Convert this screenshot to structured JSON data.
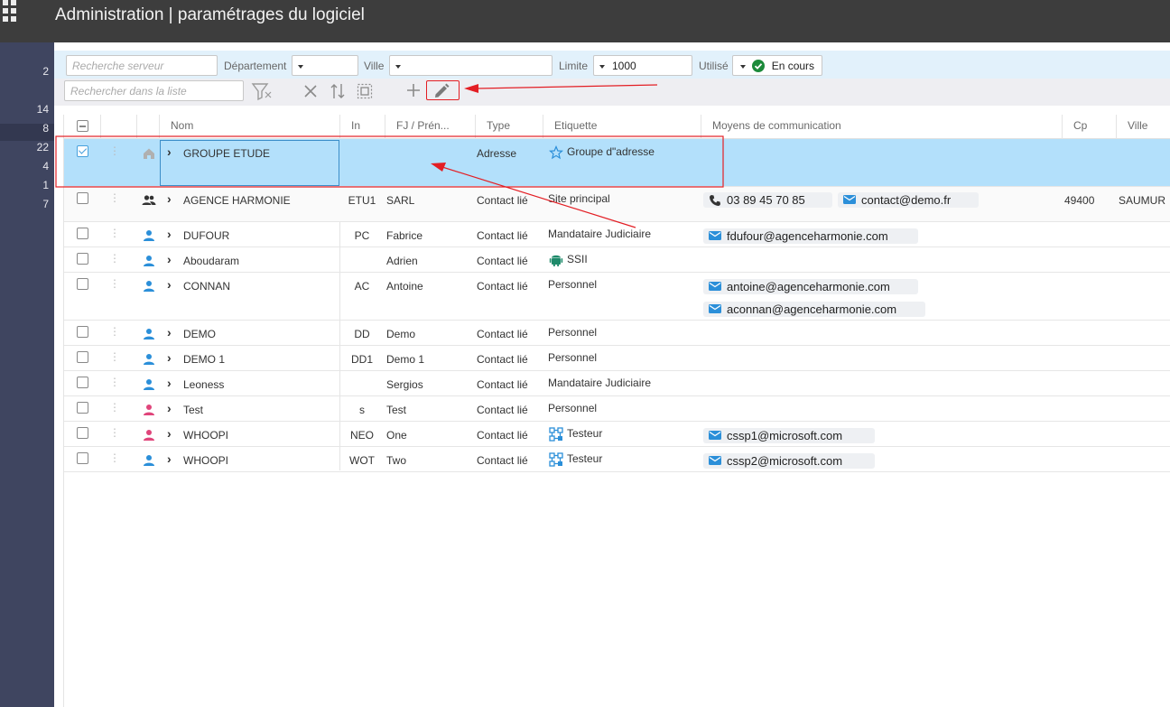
{
  "header": {
    "title": "Administration | paramétrages du logiciel"
  },
  "rail": {
    "items": [
      "2",
      "14",
      "8",
      "22",
      "4",
      "1",
      "7"
    ]
  },
  "filters": {
    "server_placeholder": "Recherche serveur",
    "department_label": "Département",
    "city_label": "Ville",
    "limit_label": "Limite",
    "limit_value": "1000",
    "used_label": "Utilisé",
    "used_value": "En cours",
    "list_search_placeholder": "Rechercher dans la liste"
  },
  "columns": [
    "Nom",
    "In",
    "FJ / Prén...",
    "Type",
    "Etiquette",
    "Moyens de communication",
    "Cp",
    "Ville"
  ],
  "rows": [
    {
      "nom": "GROUPE ETUDE",
      "in": "",
      "fj": "",
      "type": "Adresse",
      "etiquette": "Groupe d\"adresse",
      "cp": "",
      "ville": "",
      "icon": "home-icon",
      "tag_icon": "star-icon",
      "checked": true,
      "selected": true
    },
    {
      "nom": "AGENCE HARMONIE",
      "in": "ETU1",
      "fj": "SARL",
      "type": "Contact lié",
      "etiquette": "Site principal",
      "phone": "03 89 45 70 85",
      "email": "contact@demo.fr",
      "cp": "49400",
      "ville": "SAUMUR",
      "icon": "group-icon"
    },
    {
      "nom": "DUFOUR",
      "in": "PC",
      "fj": "Fabrice",
      "type": "Contact lié",
      "etiquette": "Mandataire Judiciaire",
      "email": "fdufour@agenceharmonie.com",
      "icon": "person-icon"
    },
    {
      "nom": "Aboudaram",
      "in": "",
      "fj": "Adrien",
      "type": "Contact lié",
      "etiquette": "SSII",
      "icon": "person-icon",
      "tag_icon": "android-icon"
    },
    {
      "nom": "CONNAN",
      "in": "AC",
      "fj": "Antoine",
      "type": "Contact lié",
      "etiquette": "Personnel",
      "email": "antoine@agenceharmonie.com",
      "email2": "aconnan@agenceharmonie.com",
      "icon": "person-icon"
    },
    {
      "nom": "DEMO",
      "in": "DD",
      "fj": "Demo",
      "type": "Contact lié",
      "etiquette": "Personnel",
      "icon": "person-icon"
    },
    {
      "nom": "DEMO 1",
      "in": "DD1",
      "fj": "Demo 1",
      "type": "Contact lié",
      "etiquette": "Personnel",
      "icon": "person-icon"
    },
    {
      "nom": "Leoness",
      "in": "",
      "fj": "Sergios",
      "type": "Contact lié",
      "etiquette": "Mandataire Judiciaire",
      "icon": "person-icon"
    },
    {
      "nom": "Test",
      "in": "s",
      "fj": "Test",
      "type": "Contact lié",
      "etiquette": "Personnel",
      "icon": "person-female-icon"
    },
    {
      "nom": "WHOOPI",
      "in": "NEO",
      "fj": "One",
      "type": "Contact lié",
      "etiquette": "Testeur",
      "email": "cssp1@microsoft.com",
      "icon": "person-female-icon",
      "tag_icon": "network-icon"
    },
    {
      "nom": "WHOOPI",
      "in": "WOT",
      "fj": "Two",
      "type": "Contact lié",
      "etiquette": "Testeur",
      "email": "cssp2@microsoft.com",
      "icon": "person-icon",
      "tag_icon": "network-icon"
    }
  ],
  "colors": {
    "topbar": "#3d3d3d",
    "rail": "#3f4560",
    "selected_row": "#b3e0fb",
    "accent_blue": "#2b8fd9",
    "annotation_red": "#e31e24",
    "check_green": "#1c8a3a"
  }
}
